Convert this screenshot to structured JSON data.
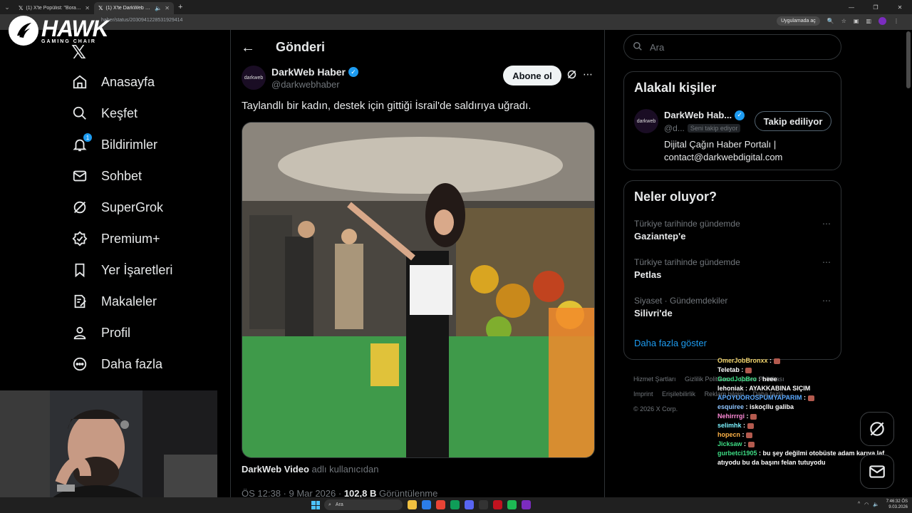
{
  "browser": {
    "tabs": [
      {
        "title": "(1) X'te Popülist: \"Boran Kuzum",
        "active": false
      },
      {
        "title": "(1) X'te DarkWeb Haber: \"Ta",
        "active": true
      }
    ],
    "url": "haber/status/2030941228531929414",
    "open_in_app": "Uygulamada aç"
  },
  "overlay": {
    "logo_name": "HAWK",
    "logo_subtitle": "GAMING CHAIR"
  },
  "nav": {
    "items": [
      {
        "label": "Anasayfa",
        "icon": "home-icon"
      },
      {
        "label": "Keşfet",
        "icon": "search-icon"
      },
      {
        "label": "Bildirimler",
        "icon": "bell-icon",
        "badge": "1"
      },
      {
        "label": "Sohbet",
        "icon": "mail-icon"
      },
      {
        "label": "SuperGrok",
        "icon": "grok-icon"
      },
      {
        "label": "Premium+",
        "icon": "premium-icon"
      },
      {
        "label": "Yer İşaretleri",
        "icon": "bookmark-icon"
      },
      {
        "label": "Makaleler",
        "icon": "articles-icon"
      },
      {
        "label": "Profil",
        "icon": "profile-icon"
      },
      {
        "label": "Daha fazla",
        "icon": "more-circle-icon"
      }
    ]
  },
  "post": {
    "page_title": "Gönderi",
    "author_name": "DarkWeb Haber",
    "author_handle": "@darkwebhaber",
    "avatar_text": "darkweb",
    "subscribe_label": "Abone ol",
    "text": "Taylandlı bir kadın, destek için gittiği İsrail'de saldırıya uğradı.",
    "credit_name": "DarkWeb Video",
    "credit_suffix": "adlı kullanıcıdan",
    "timestamp": "ÖS 12:38 · 9 Mar 2026 ·",
    "views_value": "102,8 B",
    "views_label": "Görüntülenme"
  },
  "search": {
    "placeholder": "Ara"
  },
  "related": {
    "title": "Alakalı kişiler",
    "name": "DarkWeb Hab...",
    "handle": "@d...",
    "follows_you": "Seni takip ediyor",
    "following_label": "Takip ediliyor",
    "bio": "Dijital Çağın Haber Portalı | contact@darkwebdigital.com"
  },
  "trends": {
    "title": "Neler oluyor?",
    "items": [
      {
        "context": "Türkiye tarihinde gündemde",
        "name": "Gaziantep'e"
      },
      {
        "context": "Türkiye tarihinde gündemde",
        "name": "Petlas"
      },
      {
        "context": "Siyaset · Gündemdekiler",
        "name": "Silivri'de"
      }
    ],
    "show_more": "Daha fazla göster"
  },
  "footer": {
    "links": [
      "Hizmet Şartları",
      "Gizlilik Politikası",
      "Çerez Politikası",
      "Imprint",
      "Erişilebilirlik",
      "Reklam bilgisi",
      "Daha fazla ..."
    ],
    "copyright": "© 2026 X Corp."
  },
  "chat": [
    {
      "user": "OmerJobBronxx",
      "msg": "",
      "color": "#f5d76e",
      "emote": true
    },
    {
      "user": "Teletab",
      "msg": "",
      "color": "#ffffff",
      "emote": true
    },
    {
      "user": "GoodJobBro",
      "msg": "heee",
      "color": "#3ddc84",
      "emote": false
    },
    {
      "user": "lehoniak",
      "msg": "AYAKKABINA SIÇIM",
      "color": "#ffffff",
      "emote": false
    },
    {
      "user": "APOYUOROSPUMYAPARIM",
      "msg": "",
      "color": "#5aa9ff",
      "emote": true
    },
    {
      "user": "esquiree",
      "msg": "iskoçllu galiba",
      "color": "#8ec5ff",
      "emote": false
    },
    {
      "user": "Nehirrrgi",
      "msg": "",
      "color": "#ff8ad8",
      "emote": true
    },
    {
      "user": "selimhk",
      "msg": "",
      "color": "#7cf3ff",
      "emote": true
    },
    {
      "user": "hopecn",
      "msg": "",
      "color": "#ffb347",
      "emote": true
    },
    {
      "user": "Jicksaw",
      "msg": "",
      "color": "#3ddc84",
      "emote": true
    },
    {
      "user": "gurbetci1905",
      "msg": "bu şey değilmi otobüste adam karıya laf atıyodu bu da başını felan tutuyodu",
      "color": "#3ddc84",
      "emote": false
    }
  ],
  "taskbar": {
    "search_placeholder": "Ara",
    "time": "7:46:32 ÖS",
    "date": "9.03.2026"
  },
  "colors": {
    "accent": "#1d9bf0",
    "background": "#000000",
    "border": "#2f3336",
    "muted": "#71767b"
  }
}
